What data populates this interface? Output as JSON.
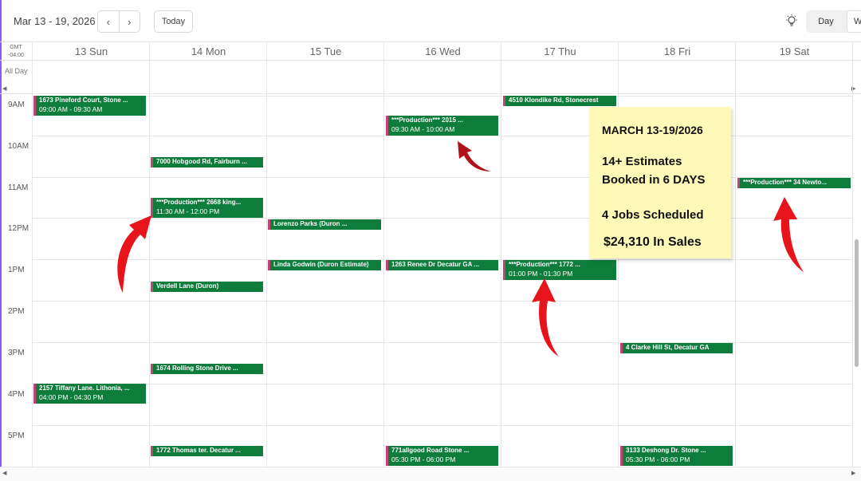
{
  "toolbar": {
    "date_range": "Mar 13 - 19, 2026",
    "prev": "‹",
    "next": "›",
    "today": "Today",
    "view_day": "Day",
    "view_week": "W"
  },
  "timezone": {
    "line1": "GMT",
    "line2": "-04:00"
  },
  "all_day_label": "All Day",
  "days": [
    "13 Sun",
    "14 Mon",
    "15 Tue",
    "16 Wed",
    "17 Thu",
    "18 Fri",
    "19 Sat"
  ],
  "hours": [
    "9AM",
    "10AM",
    "11AM",
    "12PM",
    "1PM",
    "2PM",
    "3PM",
    "4PM",
    "5PM"
  ],
  "events": {
    "sun_1": {
      "title": "1673 Pineford Court, Stone ...",
      "time": "09:00 AM - 09:30 AM"
    },
    "sun_2": {
      "title": "2157 Tiffany Lane.  Lithonia, ...",
      "time": "04:00 PM - 04:30 PM"
    },
    "mon_1": {
      "title": "7000 Hobgood Rd, Fairburn ..."
    },
    "mon_2": {
      "title": "***Production*** 2668 king...",
      "time": "11:30 AM - 12:00 PM"
    },
    "mon_3": {
      "title": "Verdell Lane (Duron)"
    },
    "mon_4": {
      "title": "1674 Rolling Stone Drive ..."
    },
    "mon_5": {
      "title": "1772 Thomas ter. Decatur ..."
    },
    "tue_1": {
      "title": "Lorenzo Parks (Duron ..."
    },
    "tue_2": {
      "title": "Linda Godwin (Duron Estimate)"
    },
    "wed_1": {
      "title": "***Production*** 2015 ...",
      "time": "09:30 AM - 10:00 AM"
    },
    "wed_2": {
      "title": "1263 Renee Dr Decatur GA ..."
    },
    "wed_3": {
      "title": "771allgood Road Stone ...",
      "time": "05:30 PM - 06:00 PM"
    },
    "thu_1": {
      "title": "4510 Klondike Rd, Stonecrest"
    },
    "thu_2": {
      "title": "***Production*** 1772 ...",
      "time": "01:00 PM - 01:30 PM"
    },
    "fri_1": {
      "title": "4 Clarke Hill St, Decatur GA"
    },
    "fri_2": {
      "title": "3133 Deshong Dr. Stone ...",
      "time": "05:30 PM - 06:00 PM"
    },
    "sat_1": {
      "title": "***Production*** 34 Newto..."
    }
  },
  "note": {
    "line1": "MARCH 13-19/2026",
    "line2": "14+ Estimates",
    "line3": "Booked in 6 DAYS",
    "line4": "4  Jobs Scheduled",
    "line5": "$24,310   In Sales"
  },
  "colors": {
    "event_bg": "#0e7c3a",
    "event_accent": "#c8407a",
    "note_bg": "#fff9b8",
    "arrow": "#e8141c"
  }
}
